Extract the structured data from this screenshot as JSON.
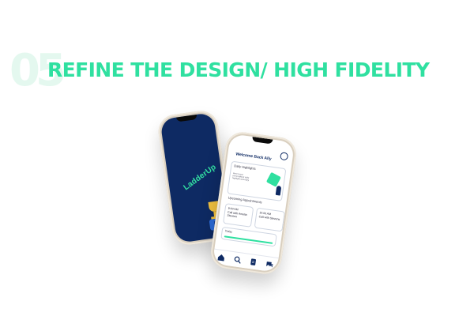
{
  "heading": {
    "step_number": "05",
    "title": "REFINE THE DESIGN/ HIGH FIDELITY"
  },
  "splash_phone": {
    "logo_text": "LadderUp"
  },
  "home_phone": {
    "welcome": "Welcome Back Ally",
    "daily_highlights_label": "Daily Highlights",
    "highlights_note": "Here's your personalized daily highlight summary",
    "upcoming_label": "Upcoming Appointments",
    "appointments": [
      {
        "time": "9:00 AM",
        "who": "Call with Amelia Stevens"
      },
      {
        "time": "10:00 AM",
        "who": "Call with Stevens"
      }
    ],
    "today_label": "Today"
  },
  "colors": {
    "accent": "#2fe0a0",
    "navy": "#0e2a63",
    "step_number_tint": "#e4f8ef"
  },
  "icons": [
    "home-icon",
    "search-icon",
    "document-icon",
    "chat-icon",
    "trophy-icon"
  ]
}
